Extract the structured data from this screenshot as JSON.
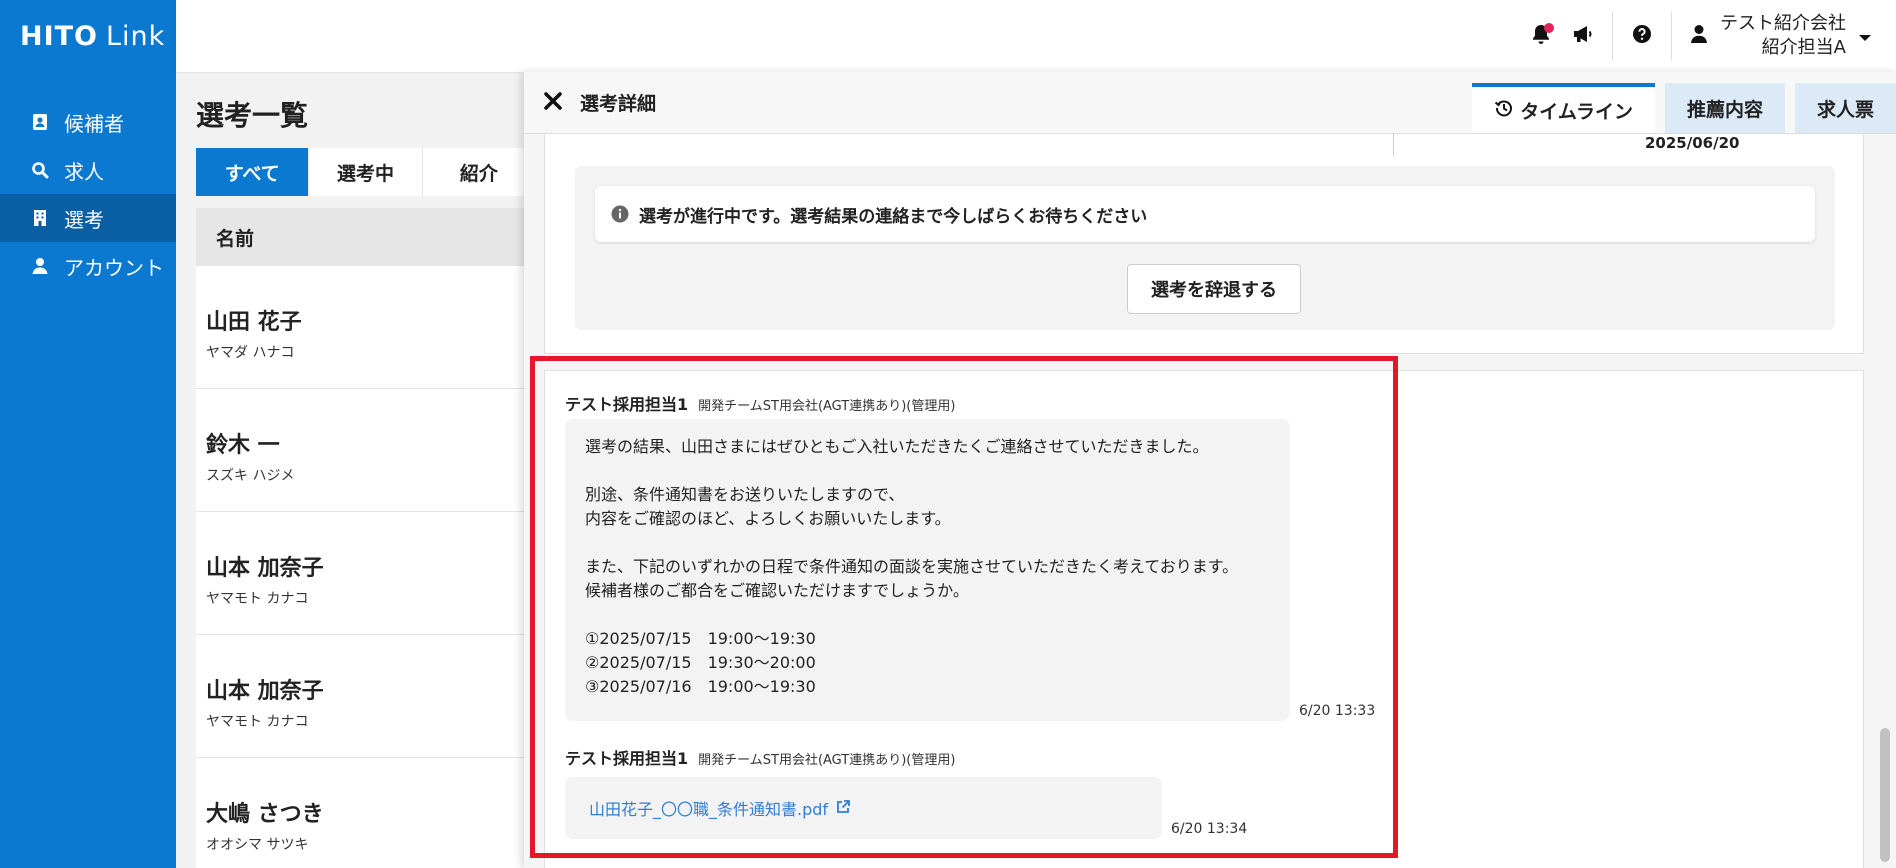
{
  "app": {
    "logo_main": "HITO",
    "logo_sub": "Link"
  },
  "sidebar": {
    "items": [
      {
        "label": "候補者",
        "icon": "contact-card-icon"
      },
      {
        "label": "求人",
        "icon": "search-icon"
      },
      {
        "label": "選考",
        "icon": "building-icon"
      },
      {
        "label": "アカウント",
        "icon": "person-icon"
      }
    ],
    "active_index": 2
  },
  "header": {
    "company": "テスト紹介会社",
    "user": "紹介担当A",
    "colors": {
      "notification_dot": "#e0245e"
    }
  },
  "list_page": {
    "title": "選考一覧",
    "tabs": [
      "すべて",
      "選考中",
      "紹介"
    ],
    "active_tab": 0,
    "column_name": "名前",
    "rows": [
      {
        "name": "山田 花子",
        "kana": "ヤマダ ハナコ"
      },
      {
        "name": "鈴木 一",
        "kana": "スズキ ハジメ"
      },
      {
        "name": "山本 加奈子",
        "kana": "ヤマモト カナコ"
      },
      {
        "name": "山本 加奈子",
        "kana": "ヤマモト カナコ"
      },
      {
        "name": "大嶋 さつき",
        "kana": "オオシマ サツキ"
      }
    ]
  },
  "detail": {
    "title": "選考詳細",
    "tabs": [
      "タイムライン",
      "推薦内容",
      "求人票"
    ],
    "active_tab": 0,
    "top_date": "2025/06/20",
    "status_notice": "選考が進行中です。選考結果の連絡まで今しばらくお待ちください",
    "withdraw_button": "選考を辞退する",
    "messages": [
      {
        "author": "テスト採用担当1",
        "org": "開発チームST用会社(AGT連携あり)(管理用)",
        "lines": [
          "選考の結果、山田さまにはぜひともご入社いただきたくご連絡させていただきました。",
          "",
          "別途、条件通知書をお送りいたしますので、",
          "内容をご確認のほど、よろしくお願いいたします。",
          "",
          "また、下記のいずれかの日程で条件通知の面談を実施させていただきたく考えております。",
          "候補者様のご都合をご確認いただけますでしょうか。",
          "",
          "①2025/07/15　19:00〜19:30",
          "②2025/07/15　19:30〜20:00",
          "③2025/07/16　19:00〜19:30"
        ],
        "time": "6/20 13:33"
      },
      {
        "author": "テスト採用担当1",
        "org": "開発チームST用会社(AGT連携あり)(管理用)",
        "attachment": "山田花子_〇〇職_条件通知書.pdf",
        "time": "6/20 13:34"
      }
    ]
  },
  "colors": {
    "primary": "#0b79d0",
    "sidebar_active": "#0a5ea3",
    "link": "#2e7dd6",
    "highlight_border": "#e4182b"
  }
}
